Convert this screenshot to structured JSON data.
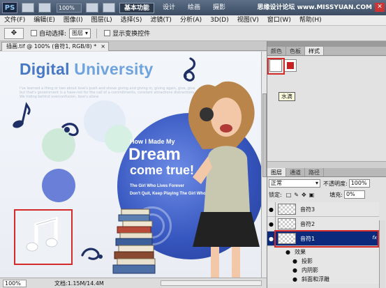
{
  "titlebar": {
    "logo": "PS",
    "zoom": "100%",
    "workspace_buttons": [
      "基本功能",
      "设计",
      "绘画",
      "摄影"
    ],
    "watermark": "思缘设计论坛 www.MISSYUAN.COM"
  },
  "menubar": {
    "items": [
      "文件(F)",
      "编辑(E)",
      "图像(I)",
      "图层(L)",
      "选择(S)",
      "滤镜(T)",
      "分析(A)",
      "3D(D)",
      "视图(V)",
      "窗口(W)",
      "帮助(H)"
    ]
  },
  "options": {
    "auto_select_label": "自动选择:",
    "auto_select_value": "图层",
    "show_transform_label": "显示变换控件"
  },
  "document": {
    "tab_title": "插画.tif @ 100% (音符1, RGB/8) *",
    "close": "×"
  },
  "artwork": {
    "brand_title_a": "Digital",
    "brand_title_b": "University",
    "filler": "I've learned a thing or two about love's push and shove giving and giving in, giving again, give, give but that's government is a have-not for the call of a commitments, constant attractions distractions. We hiding behind overconfusion, love's alone",
    "poster_line1": "How I Made My",
    "poster_dream": "Dream",
    "poster_come": "come true!",
    "poster_sub1": "The Girl Who Lives Forever",
    "poster_sub2": "Don't Quit, Keep Playing The Girl Who Lives"
  },
  "statusbar": {
    "zoom": "100%",
    "doc_info": "文档:1.15M/14.4M"
  },
  "styles_panel": {
    "tabs": [
      "颜色",
      "色板",
      "样式"
    ],
    "tooltip": "水滴"
  },
  "layers_panel": {
    "tabs": [
      "图层",
      "通道",
      "路径"
    ],
    "blend_mode": "正常",
    "opacity_label": "不透明度:",
    "opacity_value": "100%",
    "lock_label": "锁定:",
    "fill_label": "填充:",
    "fill_value": "0%",
    "layers": [
      {
        "name": "音符3"
      },
      {
        "name": "音符2"
      },
      {
        "name": "音符1"
      }
    ],
    "fx_badge": "fx",
    "effects_label": "效果",
    "effects": [
      "投影",
      "内阴影",
      "斜面和浮雕"
    ]
  },
  "colors": {
    "accent_blue": "#4778c5",
    "highlight_red": "#d42a2a",
    "selection_blue": "#0b2a7c"
  }
}
